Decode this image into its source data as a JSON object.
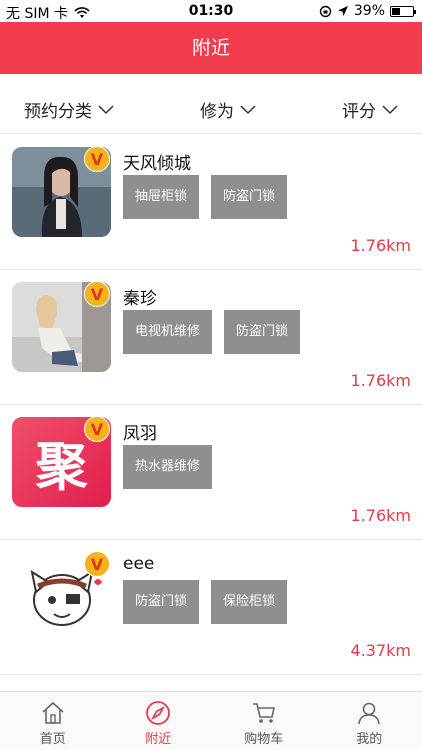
{
  "status": {
    "carrier": "无 SIM 卡",
    "time": "01:30",
    "battery": "39%"
  },
  "nav": {
    "title": "附近"
  },
  "filters": [
    {
      "label": "预约分类"
    },
    {
      "label": "修为"
    },
    {
      "label": "评分"
    }
  ],
  "items": [
    {
      "name": "天风倾城",
      "tags": [
        "抽屉柜锁",
        "防盗门锁"
      ],
      "distance": "1.76km",
      "badge": "V"
    },
    {
      "name": "秦珍",
      "tags": [
        "电视机维修",
        "防盗门锁"
      ],
      "distance": "1.76km",
      "badge": "V"
    },
    {
      "name": "凤羽",
      "tags": [
        "热水器维修"
      ],
      "distance": "1.76km",
      "badge": "V",
      "logo_text": "聚"
    },
    {
      "name": "eee",
      "tags": [
        "防盗门锁",
        "保险柜锁"
      ],
      "distance": "4.37km",
      "badge": "V"
    }
  ],
  "tabs": [
    {
      "label": "首页",
      "icon": "home-icon"
    },
    {
      "label": "附近",
      "icon": "compass-icon"
    },
    {
      "label": "购物车",
      "icon": "cart-icon"
    },
    {
      "label": "我的",
      "icon": "user-icon"
    }
  ],
  "colors": {
    "accent": "#f23c4d",
    "tag_bg": "#8f8f8f",
    "distance": "#e23a4a",
    "badge": "#f5b21c"
  }
}
